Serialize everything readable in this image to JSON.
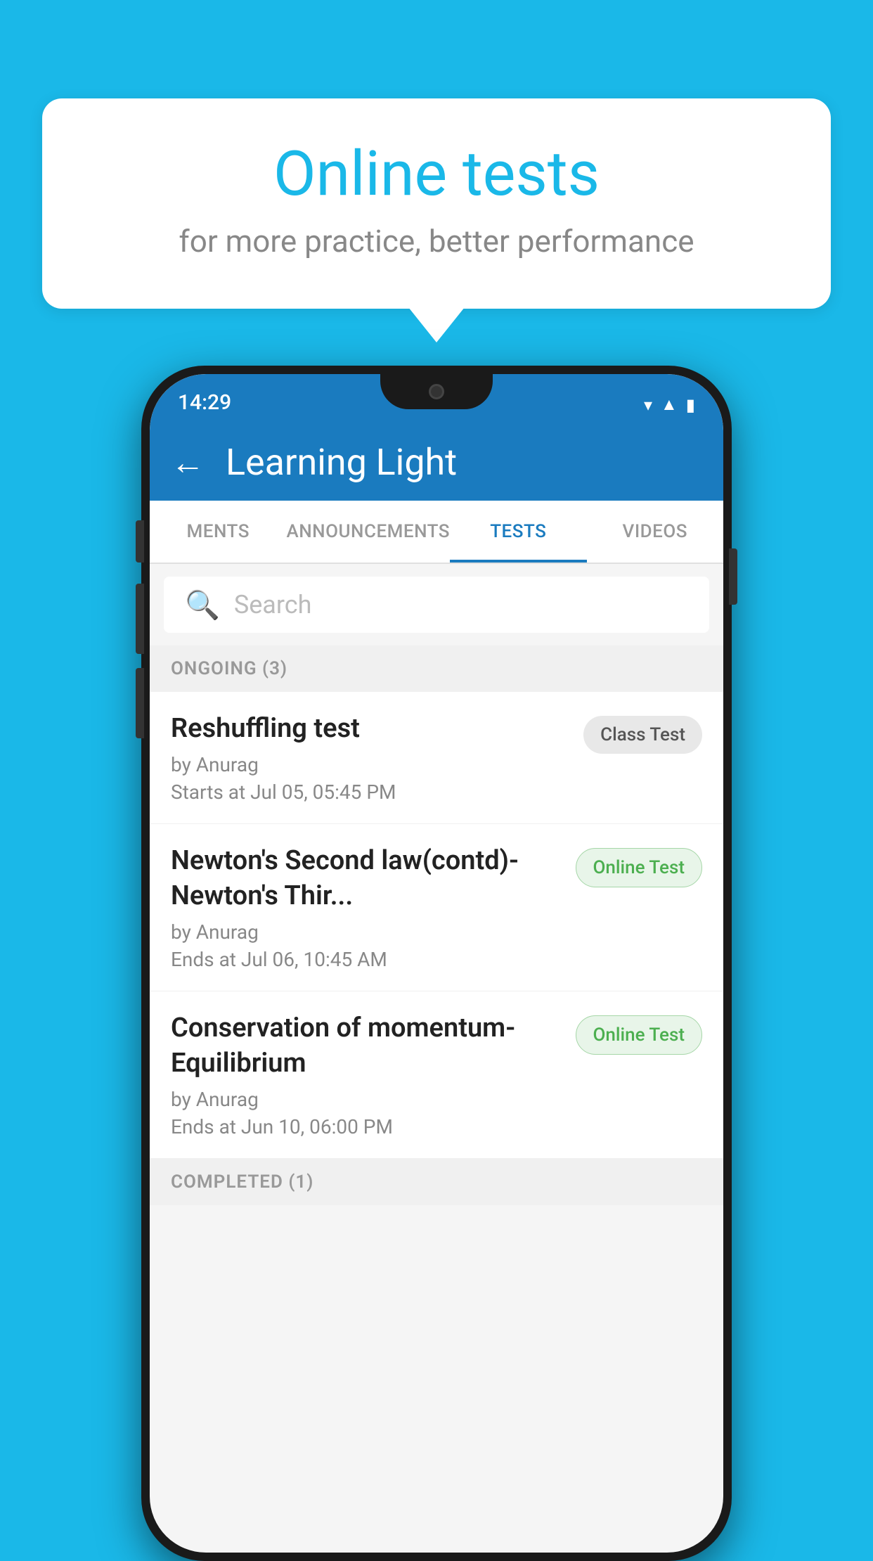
{
  "background_color": "#1ab8e8",
  "bubble": {
    "title": "Online tests",
    "subtitle": "for more practice, better performance"
  },
  "phone": {
    "status_bar": {
      "time": "14:29",
      "icons": [
        "wifi",
        "signal",
        "battery"
      ]
    },
    "app_bar": {
      "title": "Learning Light",
      "back_label": "←"
    },
    "tabs": [
      {
        "label": "MENTS",
        "active": false
      },
      {
        "label": "ANNOUNCEMENTS",
        "active": false
      },
      {
        "label": "TESTS",
        "active": true
      },
      {
        "label": "VIDEOS",
        "active": false
      }
    ],
    "search": {
      "placeholder": "Search"
    },
    "sections": [
      {
        "header": "ONGOING (3)",
        "items": [
          {
            "name": "Reshuffling test",
            "by": "by Anurag",
            "time": "Starts at  Jul 05, 05:45 PM",
            "badge": "Class Test",
            "badge_type": "class"
          },
          {
            "name": "Newton's Second law(contd)-Newton's Thir...",
            "by": "by Anurag",
            "time": "Ends at  Jul 06, 10:45 AM",
            "badge": "Online Test",
            "badge_type": "online"
          },
          {
            "name": "Conservation of momentum-Equilibrium",
            "by": "by Anurag",
            "time": "Ends at  Jun 10, 06:00 PM",
            "badge": "Online Test",
            "badge_type": "online"
          }
        ]
      },
      {
        "header": "COMPLETED (1)",
        "items": []
      }
    ]
  }
}
